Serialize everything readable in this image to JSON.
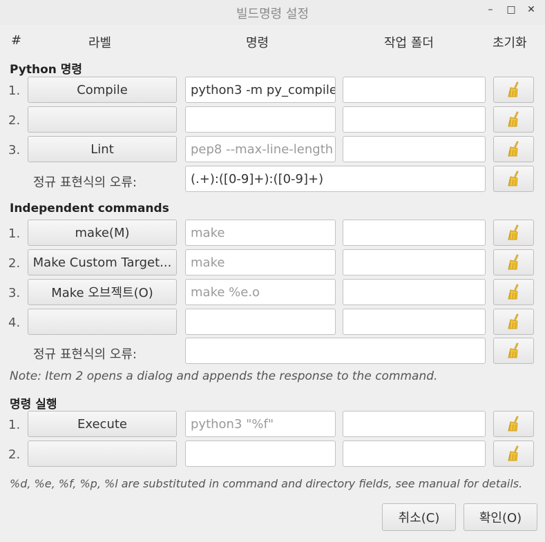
{
  "window": {
    "title": "빌드명령 설정",
    "minimize": "–",
    "maximize": "□",
    "close": "✕"
  },
  "headers": {
    "num": "#",
    "label": "라벨",
    "command": "명령",
    "workdir": "작업 폴더",
    "reset": "초기화"
  },
  "python": {
    "title": "Python 명령",
    "rows": [
      {
        "num": "1.",
        "label": "Compile",
        "command": "python3 -m py_compile",
        "command_placeholder": "",
        "workdir": ""
      },
      {
        "num": "2.",
        "label": "",
        "command": "",
        "command_placeholder": "",
        "workdir": ""
      },
      {
        "num": "3.",
        "label": "Lint",
        "command": "",
        "command_placeholder": "pep8 --max-line-length",
        "workdir": ""
      }
    ],
    "regex_label": "정규 표현식의 오류:",
    "regex_value": "(.+):([0-9]+):([0-9]+)"
  },
  "independent": {
    "title": "Independent commands",
    "rows": [
      {
        "num": "1.",
        "label": "make(M)",
        "command": "",
        "command_placeholder": "make",
        "workdir": ""
      },
      {
        "num": "2.",
        "label": "Make Custom Target...",
        "command": "",
        "command_placeholder": "make",
        "workdir": ""
      },
      {
        "num": "3.",
        "label": "Make 오브젝트(O)",
        "command": "",
        "command_placeholder": "make %e.o",
        "workdir": ""
      },
      {
        "num": "4.",
        "label": "",
        "command": "",
        "command_placeholder": "",
        "workdir": ""
      }
    ],
    "regex_label": "정규 표현식의 오류:",
    "regex_value": "",
    "note": "Note: Item 2 opens a dialog and appends the response to the command."
  },
  "execute": {
    "title": "명령 실행",
    "rows": [
      {
        "num": "1.",
        "label": "Execute",
        "command": "",
        "command_placeholder": "python3 \"%f\"",
        "workdir": ""
      },
      {
        "num": "2.",
        "label": "",
        "command": "",
        "command_placeholder": "",
        "workdir": ""
      }
    ]
  },
  "footer_note": "%d, %e, %f, %p, %l are substituted in command and directory fields, see manual for details.",
  "buttons": {
    "cancel": "취소(C)",
    "ok": "확인(O)"
  },
  "icons": {
    "clear": "broom-icon"
  }
}
